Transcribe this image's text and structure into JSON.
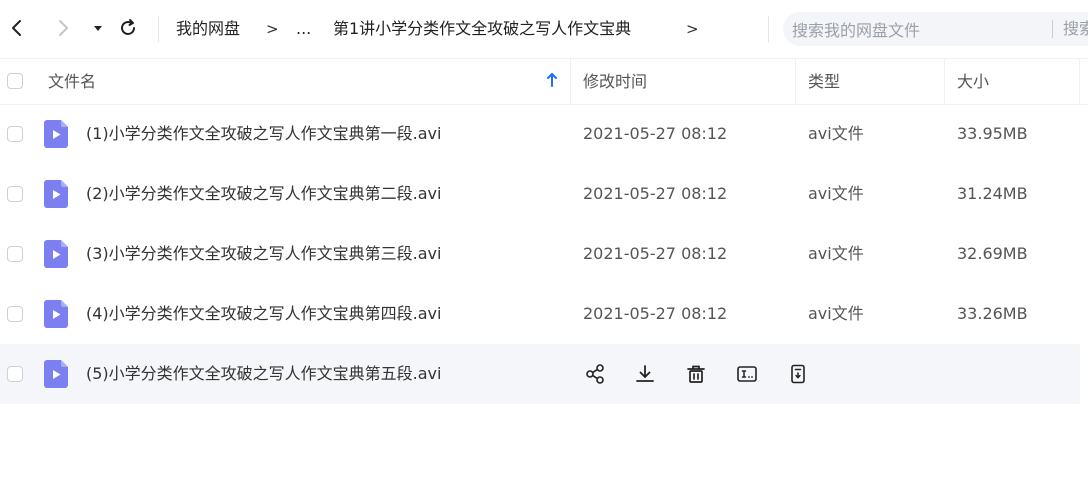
{
  "toolbar": {
    "breadcrumb": {
      "root": "我的网盘",
      "sep1": ">",
      "ellipsis": "...",
      "current": "第1讲小学分类作文全攻破之写人作文宝典",
      "sep2": ">"
    },
    "search": {
      "placeholder": "搜索我的网盘文件",
      "extra": "搜索"
    }
  },
  "table": {
    "columns": {
      "name": "文件名",
      "modified": "修改时间",
      "type": "类型",
      "size": "大小"
    },
    "sort_column": "name",
    "sort_direction": "asc",
    "rows": [
      {
        "name": "(1)小学分类作文全攻破之写人作文宝典第一段.avi",
        "modified": "2021-05-27 08:12",
        "type": "avi文件",
        "size": "33.95MB"
      },
      {
        "name": "(2)小学分类作文全攻破之写人作文宝典第二段.avi",
        "modified": "2021-05-27 08:12",
        "type": "avi文件",
        "size": "31.24MB"
      },
      {
        "name": "(3)小学分类作文全攻破之写人作文宝典第三段.avi",
        "modified": "2021-05-27 08:12",
        "type": "avi文件",
        "size": "32.69MB"
      },
      {
        "name": "(4)小学分类作文全攻破之写人作文宝典第四段.avi",
        "modified": "2021-05-27 08:12",
        "type": "avi文件",
        "size": "33.26MB"
      },
      {
        "name": "(5)小学分类作文全攻破之写人作文宝典第五段.avi",
        "hover_actions": [
          "share-icon",
          "download-icon",
          "delete-icon",
          "rename-icon",
          "more-icon"
        ]
      }
    ]
  },
  "colors": {
    "file_icon": "#7b7ff0",
    "accent": "#1e6fff",
    "hover_row": "#f5f6f9"
  }
}
